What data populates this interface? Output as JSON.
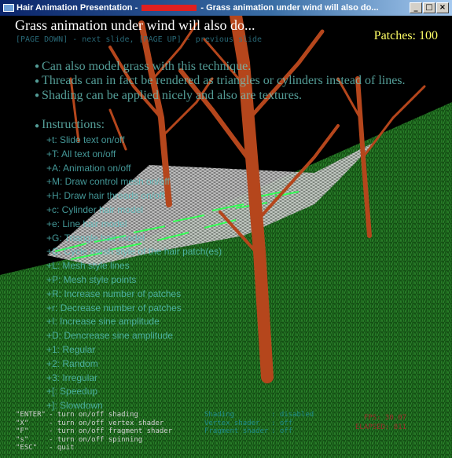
{
  "window": {
    "title_prefix": "Hair Animation Presentation - ",
    "title_suffix": " - Grass animation under wind will also do...",
    "minimize": "_",
    "maximize": "□",
    "close": "×"
  },
  "slide": {
    "title": "Grass animation under wind will also do...",
    "patches": "Patches: 100",
    "nav_hint": "[PAGE DOWN] - next slide, [PAGE UP] - previous slide",
    "bullets": [
      "Can also model grass with this technique.",
      "Threads can in fact be rendered as triangles or cylinders instead of lines.",
      "Shading can be applied nicely and also are textures."
    ],
    "instructions_title": "Instructions:",
    "instructions": [
      "+t: Slide text on/off",
      "+T: All text on/off",
      "+A: Animation on/off",
      "+M: Draw control mesh on/off",
      "+H: Draw hair threads on/off",
      "+c: Cylinder hair model",
      "+e: Line hair model",
      "+G: Triangle hair model",
      "+C: Cycle mesh style of the hair patch(es)",
      "+L: Mesh style lines",
      "+P: Mesh style points",
      "+R: Increase number of patches",
      "+r: Decrease number of patches",
      "+I: Increase sine amplitude",
      "+D: Dencrease sine amplitude",
      "+1: Regular",
      "+2: Random",
      "+3: Irregular",
      "+[: Speedup",
      "+]: Slowdown"
    ]
  },
  "help": [
    {
      "key": "\"ENTER\"",
      "desc": "- turn on/off shading"
    },
    {
      "key": "\"X\"",
      "desc": "- turn on/off vertex shader"
    },
    {
      "key": "\"F\"",
      "desc": "- turn on/off fragment shader"
    },
    {
      "key": "\"s\"",
      "desc": "- turn on/off spinning"
    },
    {
      "key": "\"ESC\"",
      "desc": "- quit"
    }
  ],
  "shader_status": [
    {
      "label": "Shading",
      "value": ": disabled"
    },
    {
      "label": "Vertex shader",
      "value": ": off"
    },
    {
      "label": "Fragment shader",
      "value": ": off"
    }
  ],
  "stats": {
    "fps": "FPS: 30.07",
    "elapsed": "ELAPSED: 811"
  },
  "colors": {
    "grass": "#1f6a1f",
    "tree": "#b5461c",
    "mesh": "#d8d8d8",
    "highlight": "#33ff55"
  }
}
